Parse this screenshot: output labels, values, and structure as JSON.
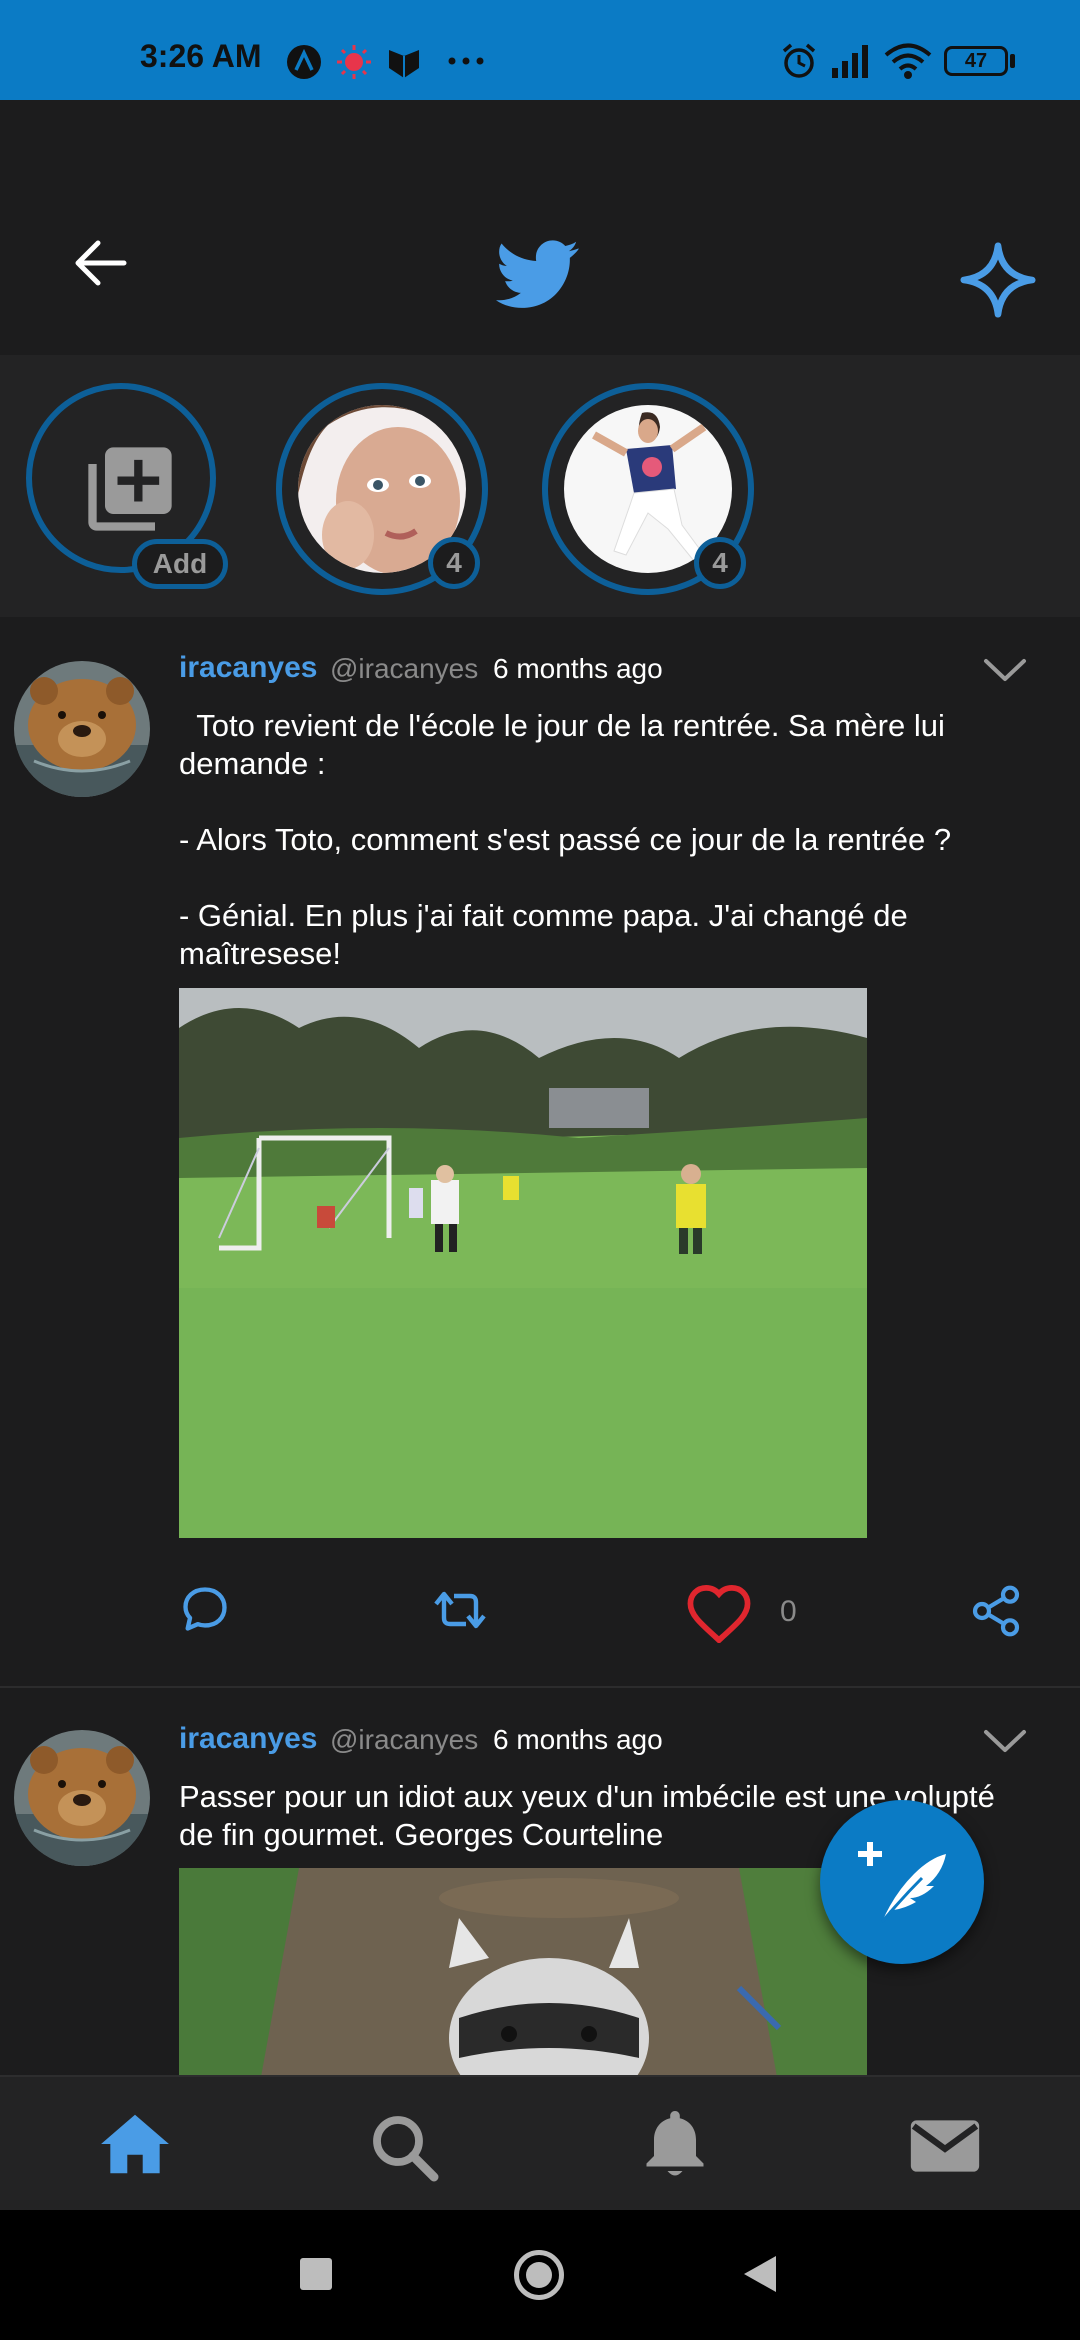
{
  "status_bar": {
    "time": "3:26 AM",
    "battery": "47",
    "icons": [
      "app-a-icon",
      "alert-dot-icon",
      "shield-app-icon",
      "more-dots-icon",
      "alarm-icon",
      "signal-icon",
      "wifi-icon",
      "battery-icon"
    ]
  },
  "header": {
    "back_icon": "arrow-left-icon",
    "logo_icon": "bird-logo-icon",
    "sparkle_icon": "sparkle-star-icon"
  },
  "stories": [
    {
      "badge": "Add",
      "icon": "add-stack-icon"
    },
    {
      "badge": "4"
    },
    {
      "badge": "4"
    }
  ],
  "tweets": [
    {
      "username": "iracanyes",
      "handle": "@iracanyes",
      "time_ago": "6 months ago",
      "text": "  Toto revient de l'école le jour de la rentrée. Sa mère lui demande :\n\n- Alors Toto, comment s'est passé ce jour de la rentrée ?\n\n- Génial. En plus j'ai fait comme papa. J'ai changé de maîtresese!",
      "likes": "0"
    },
    {
      "username": "iracanyes",
      "handle": "@iracanyes",
      "time_ago": "6 months ago",
      "text": "Passer pour un idiot aux yeux d'un imbécile est une volupté de fin gourmet. Georges Courteline"
    }
  ],
  "colors": {
    "accent": "#4a9ce6",
    "status_bar": "#0b7bc5",
    "like": "#e0262e",
    "background": "#1c1c1d"
  }
}
